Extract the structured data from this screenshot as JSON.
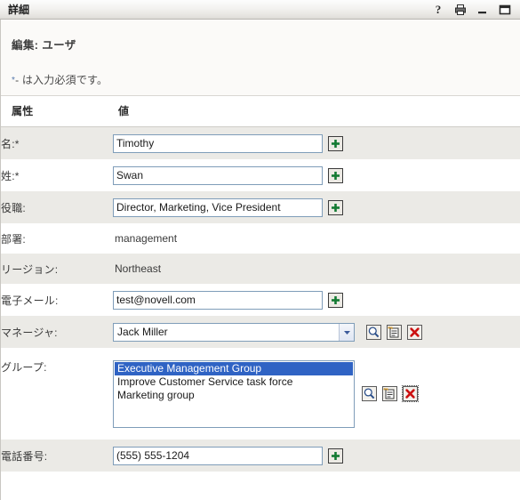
{
  "window": {
    "title": "詳細",
    "titlebar_icons": [
      {
        "name": "help-icon",
        "glyph": "?"
      },
      {
        "name": "print-icon"
      },
      {
        "name": "minimize-icon"
      },
      {
        "name": "maximize-icon"
      }
    ]
  },
  "intro": {
    "heading": "編集: ユーザ",
    "required_star": "*",
    "required_note": "- は入力必須です。"
  },
  "table": {
    "headers": {
      "attribute": "属性",
      "value": "値"
    },
    "rows": [
      {
        "label": "名:*",
        "type": "text",
        "value": "Timothy",
        "button": "add-icon"
      },
      {
        "label": "姓:*",
        "type": "text",
        "value": "Swan",
        "button": "add-icon"
      },
      {
        "label": "役職:",
        "type": "text",
        "value": "Director, Marketing, Vice President",
        "button": "add-icon"
      },
      {
        "label": "部署:",
        "type": "static",
        "value": "management"
      },
      {
        "label": "リージョン:",
        "type": "static",
        "value": "Northeast"
      },
      {
        "label": "電子メール:",
        "type": "text",
        "value": "test@novell.com",
        "button": "add-icon"
      },
      {
        "label": "マネージャ:",
        "type": "select",
        "value": "Jack Miller",
        "buttons": [
          "search-icon",
          "history-icon",
          "delete-icon"
        ]
      },
      {
        "label": "グループ:",
        "type": "listbox",
        "options": [
          "Executive Management Group",
          "Improve Customer Service task force",
          "Marketing group"
        ],
        "selected_index": 0,
        "buttons": [
          "search-icon",
          "history-icon",
          "delete-icon"
        ]
      },
      {
        "label": "電話番号:",
        "type": "text",
        "value": "(555) 555-1204",
        "button": "add-icon"
      }
    ]
  },
  "colors": {
    "title_bar_base": "#e6e4e0",
    "stripe_row": "#ebeae6",
    "plain_row": "#ffffff",
    "input_border": "#7f9db9",
    "selection_blue": "#2f63c4",
    "plus_green": "#137a32",
    "delete_red": "#cc1111"
  }
}
